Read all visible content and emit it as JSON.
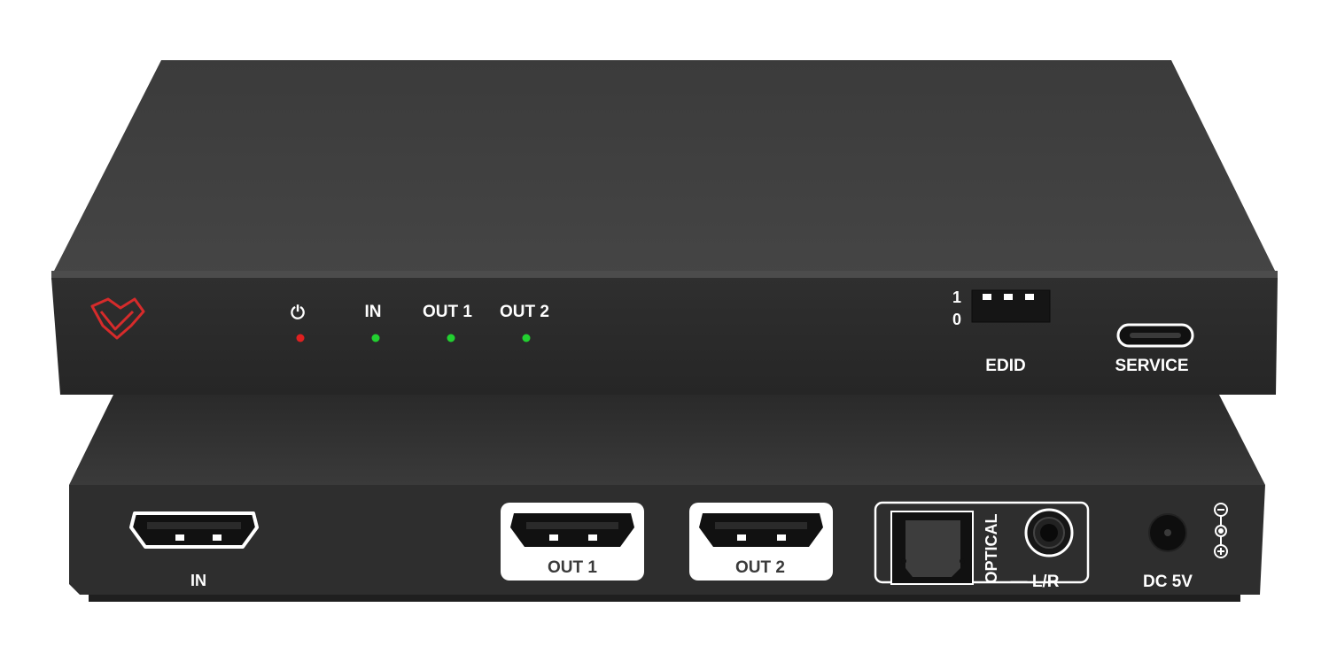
{
  "front_panel": {
    "power_label": "⏻",
    "led_labels": [
      "IN",
      "OUT 1",
      "OUT 2"
    ],
    "edid_on_label": "1",
    "edid_off_label": "0",
    "edid_label": "EDID",
    "service_label": "SERVICE",
    "power_led_color": "#e02020",
    "status_led_color": "#22d030",
    "logo_color": "#d62b2b"
  },
  "rear_panel": {
    "in_label": "IN",
    "out1_label": "OUT 1",
    "out2_label": "OUT 2",
    "optical_label": "OPTICAL",
    "lr_label": "— L/R",
    "dc_label": "DC 5V"
  }
}
